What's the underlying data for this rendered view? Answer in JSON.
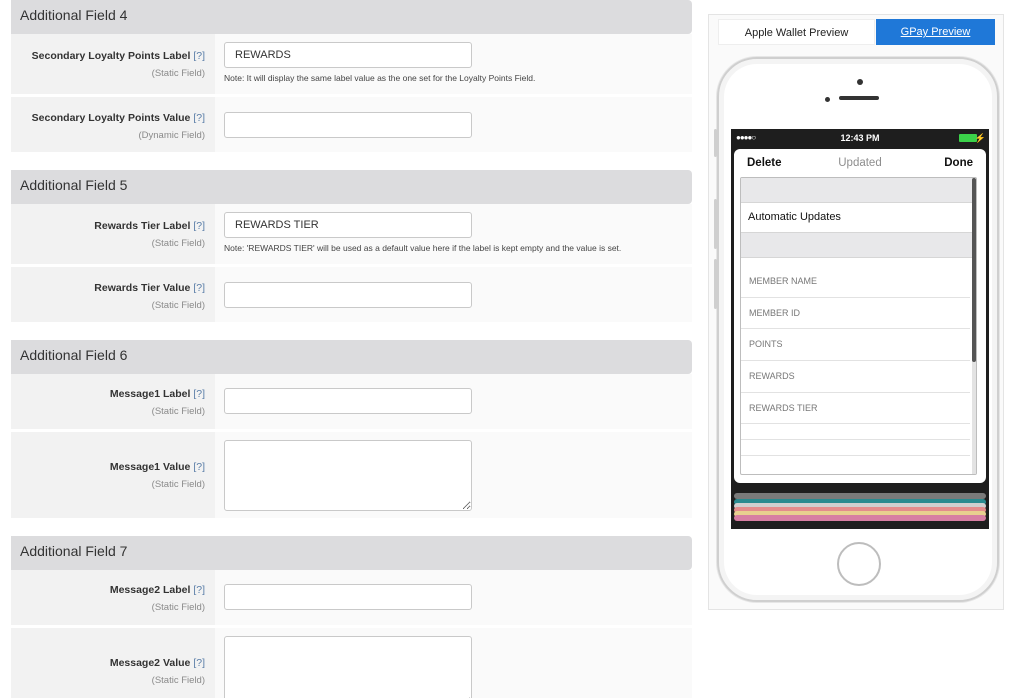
{
  "sections": [
    {
      "title": "Additional Field 4",
      "rows": [
        {
          "label": "Secondary Loyalty Points Label",
          "help": "[?]",
          "sub": "(Static Field)",
          "value": "REWARDS",
          "note": "Note: It will display the same label value as the one set for the Loyalty Points Field."
        },
        {
          "label": "Secondary Loyalty Points Value",
          "help": "[?]",
          "sub": "(Dynamic Field)",
          "value": ""
        }
      ]
    },
    {
      "title": "Additional Field 5",
      "rows": [
        {
          "label": "Rewards Tier Label",
          "help": "[?]",
          "sub": "(Static Field)",
          "value": "REWARDS TIER",
          "note": "Note: 'REWARDS TIER' will be used as a default value here if the label is kept empty and the value is set."
        },
        {
          "label": "Rewards Tier Value",
          "help": "[?]",
          "sub": "(Static Field)",
          "value": ""
        }
      ]
    },
    {
      "title": "Additional Field 6",
      "rows": [
        {
          "label": "Message1 Label",
          "help": "[?]",
          "sub": "(Static Field)",
          "value": ""
        },
        {
          "label": "Message1 Value",
          "help": "[?]",
          "sub": "(Static Field)",
          "value": ""
        }
      ]
    },
    {
      "title": "Additional Field 7",
      "rows": [
        {
          "label": "Message2 Label",
          "help": "[?]",
          "sub": "(Static Field)",
          "value": ""
        },
        {
          "label": "Message2 Value",
          "help": "[?]",
          "sub": "(Static Field)",
          "value": ""
        }
      ]
    }
  ],
  "preview": {
    "tabs": {
      "apple": "Apple Wallet Preview",
      "gpay": "GPay Preview"
    },
    "active_tab": "gpay",
    "accent_color": "#1f78d8",
    "phone": {
      "signal": "●●●●○",
      "time": "12:43 PM",
      "battery_color": "#3bd24a",
      "card": {
        "delete": "Delete",
        "updated": "Updated",
        "done": "Done",
        "automatic_updates": "Automatic Updates",
        "fields": [
          "MEMBER NAME",
          "MEMBER ID",
          "POINTS",
          "REWARDS",
          "REWARDS TIER"
        ]
      },
      "stack_colors": [
        "#7a7a7a",
        "#2a8a8f",
        "#cfcfcf",
        "#e38c8c",
        "#e8cf8f",
        "#d77ea3"
      ]
    }
  }
}
